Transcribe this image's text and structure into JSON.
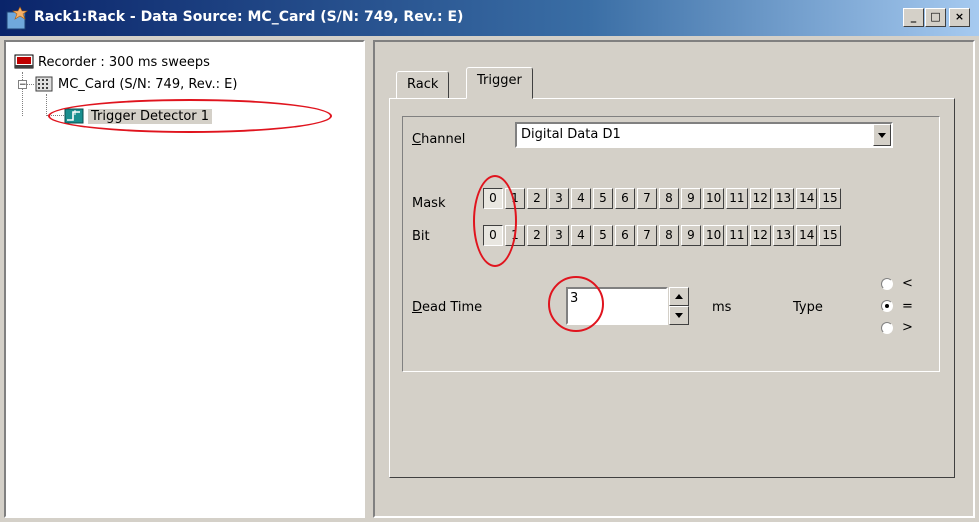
{
  "window": {
    "title": "Rack1:Rack - Data Source: MC_Card (S/N: 749, Rev.: E)",
    "min_label": "_",
    "max_label": "□",
    "close_label": "×"
  },
  "tree": {
    "items": [
      {
        "label": "Recorder : 300 ms sweeps",
        "icon": "recorder-icon"
      },
      {
        "label": "MC_Card (S/N: 749, Rev.: E)",
        "icon": "card-icon",
        "expander": "−"
      },
      {
        "label": "Trigger Detector 1",
        "icon": "trigger-detector-icon",
        "selected": true
      }
    ]
  },
  "tabs": [
    {
      "label": "Rack",
      "active": false
    },
    {
      "label": "Trigger",
      "active": true
    }
  ],
  "trigger": {
    "channel_label": "Channel",
    "channel_value": "Digital Data D1",
    "mask_label": "Mask",
    "bit_label": "Bit",
    "bits": [
      "0",
      "1",
      "2",
      "3",
      "4",
      "5",
      "6",
      "7",
      "8",
      "9",
      "10",
      "11",
      "12",
      "13",
      "14",
      "15"
    ],
    "mask_pressed": "0",
    "bit_pressed": "0",
    "dead_time_label": "Dead Time",
    "dead_time_value": "3",
    "dead_time_unit": "ms",
    "type_label": "Type",
    "type_options": [
      "<",
      "=",
      ">"
    ],
    "type_selected": "="
  },
  "colors": {
    "annotation_ring": "#e0141e",
    "titlebar_start": "#0a246a",
    "face": "#d4d0c8"
  }
}
